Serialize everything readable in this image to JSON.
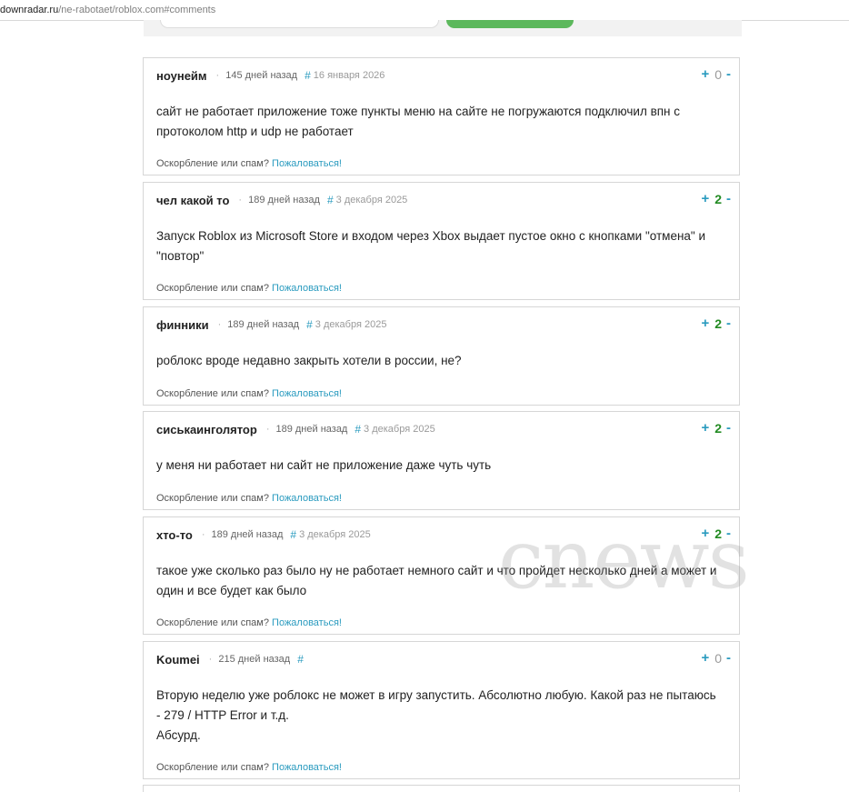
{
  "address_bar": {
    "host": "downradar.ru",
    "path": "/ne-rabotaet/roblox.com#comments"
  },
  "report": {
    "text": "Оскорбление или спам?",
    "link": "Пожаловаться!"
  },
  "vote": {
    "plus": "+",
    "minus": "-"
  },
  "comments": [
    {
      "author": "ноунейм",
      "age": "145 дней назад",
      "hash": "#",
      "date": "16 января 2026",
      "score": "0",
      "lines": [
        "сайт не работает приложение тоже пункты меню на сайте не погружаются подключил впн с",
        "протоколом http и udp не работает"
      ]
    },
    {
      "author": "чел какой то",
      "age": "189 дней назад",
      "hash": "#",
      "date": "3 декабря 2025",
      "score": "2",
      "lines": [
        "Запуск Roblox из Microsoft Store и входом через Xbox выдает пустое окно с кнопками \"отмена\" и",
        "\"повтор\""
      ]
    },
    {
      "author": "финники",
      "age": "189 дней назад",
      "hash": "#",
      "date": "3 декабря 2025",
      "score": "2",
      "lines": [
        "роблокс вроде недавно закрыть хотели в россии, не?"
      ]
    },
    {
      "author": "сиськаинголятор",
      "age": "189 дней назад",
      "hash": "#",
      "date": "3 декабря 2025",
      "score": "2",
      "lines": [
        "у меня ни работает ни сайт не приложение даже чуть чуть"
      ]
    },
    {
      "author": "хто-то",
      "age": "189 дней назад",
      "hash": "#",
      "date": "3 декабря 2025",
      "score": "2",
      "lines": [
        "такое уже сколько раз было ну не работает немного сайт и что пройдет несколько дней а может и",
        "один и все будет как было"
      ]
    },
    {
      "author": "Koumei",
      "age": "215 дней назад",
      "hash": "#",
      "date": "",
      "score": "0",
      "lines": [
        "Вторую неделю уже роблокс не может в игру запустить. Абсолютно любую. Какой раз не пытаюсь",
        "- 279 / HTTP Error и т.д.",
        "Абсурд."
      ]
    }
  ],
  "watermark": {
    "text": "cnews"
  },
  "colors": {
    "accent": "#2a9bbf",
    "positive_score": "#228b22",
    "green_button": "#5cb85c"
  }
}
